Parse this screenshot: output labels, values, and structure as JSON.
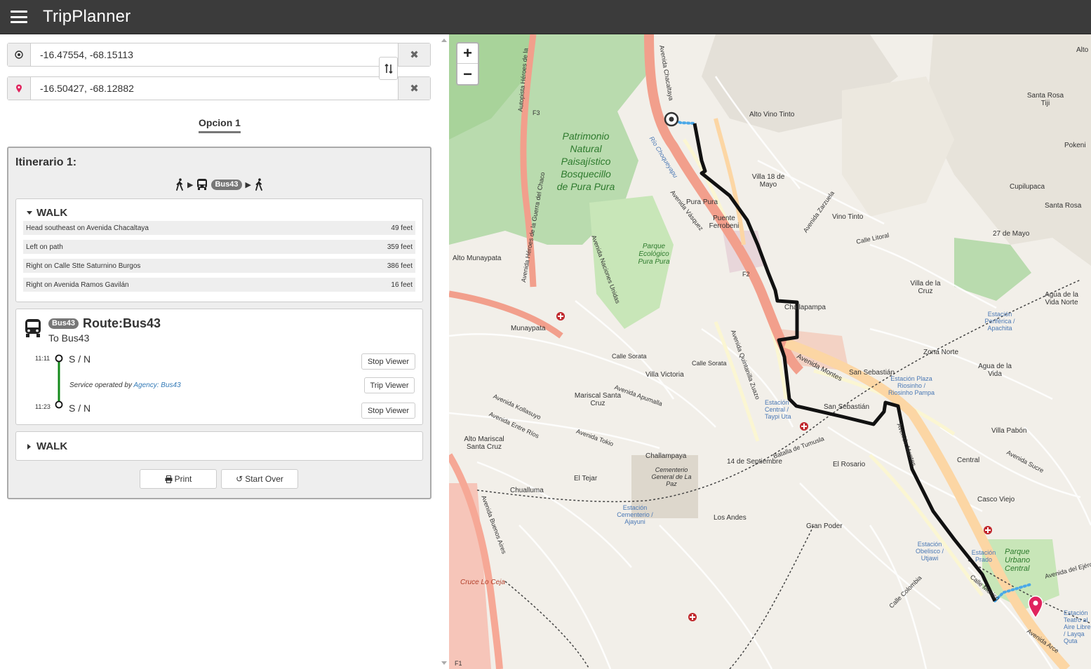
{
  "app": {
    "title": "TripPlanner"
  },
  "origin": {
    "value": "-16.47554, -68.15113"
  },
  "destination": {
    "value": "-16.50427, -68.12882"
  },
  "option_tab": "Opcion 1",
  "itinerary": {
    "title": "Itinerario 1:",
    "route_badge": "Bus43",
    "walk1": {
      "label": "WALK",
      "steps": [
        {
          "text": "Head southeast on Avenida Chacaltaya",
          "dist": "49 feet"
        },
        {
          "text": "Left on path",
          "dist": "359 feet"
        },
        {
          "text": "Right on Calle Stte Saturnino Burgos",
          "dist": "386 feet"
        },
        {
          "text": "Right on Avenida Ramos Gavilán",
          "dist": "16 feet"
        }
      ]
    },
    "transit": {
      "badge": "Bus43",
      "route": "Route:Bus43",
      "to": "To Bus43",
      "start_time": "11:11",
      "start_stop": "S / N",
      "end_time": "11:23",
      "end_stop": "S / N",
      "stop_viewer": "Stop Viewer",
      "trip_viewer": "Trip Viewer",
      "service_prefix": "Service operated by",
      "agency": "Agency: Bus43"
    },
    "walk2": {
      "label": "WALK"
    },
    "print_label": "Print",
    "start_over_label": "Start Over"
  },
  "map": {
    "zoom_in": "+",
    "zoom_out": "−",
    "labels": {
      "patrimonio": "Patrimonio Natural Paisajístico Bosquecillo de Pura Pura",
      "parque_ecologico": "Parque Ecológico Pura Pura",
      "alto_vino_tinto": "Alto Vino Tinto",
      "villa_18": "Villa 18 de Mayo",
      "vino_tinto": "Vino Tinto",
      "pura_pura": "Pura Pura",
      "puente": "Puente Ferrobeni",
      "alto_munaypata": "Alto Munaypata",
      "munaypata": "Munaypata",
      "chijini": "Challapampa",
      "villa_victoria": "Villa Victoria",
      "mariscal": "Mariscal Santa Cruz",
      "alto_mariscal": "Alto Mariscal Santa Cruz",
      "challampaya": "Challampaya",
      "el_tejar": "El Tejar",
      "chualluma": "Chualluma",
      "cementerio": "Cementerio General de La Paz",
      "est_cementerio": "Estación Cementerio / Ajayuni",
      "los_andes": "Los Andes",
      "gran_poder": "Gran Poder",
      "el_rosario": "El Rosario",
      "san_sebastian": "San Sebastián",
      "san_sebastian2": "San Sebastián",
      "zona_norte": "Zona Norte",
      "agua_vida": "Agua de la Vida",
      "agua_vida_norte": "Agua de la Vida Norte",
      "villa_cruz": "Villa de la Cruz",
      "villa_pabon": "Villa Pabón",
      "central": "Central",
      "casco_viejo": "Casco Viejo",
      "parque_urbano": "Parque Urbano Central",
      "santa_rosa": "Santa Rosa",
      "santa_rosa_tiji": "Santa Rosa Tiji",
      "cupilupaca": "Cupilupaca",
      "27_mayo": "27 de Mayo",
      "pokeni": "Pokeni",
      "alto": "Alto",
      "est_central": "Estación Central / Taypi Uta",
      "est_riosinho": "Estación Plaza Riosinho / Riosinho Pampa",
      "est_periferica": "Estación Periférica / Apachita",
      "est_obelisco": "Estación Obelisco / Utjawi",
      "est_prado": "Estación Prado",
      "est_teatro": "Estación Teatro al Aire Libre / Layqa Quta",
      "14_sept": "14 de Septiembre",
      "cruce": "Cruce Lo Ceja",
      "f1": "F1",
      "f2": "F2",
      "f3": "F3",
      "av_montes": "Avenida Montes",
      "av_chacaltaya": "Avenida Chacaltaya",
      "rio_choqueyapu": "Río Choqueyapu",
      "av_vasquez": "Avenida Vásquez",
      "av_quintanilla": "Avenida Quintanilla Zuazo",
      "av_arce": "Avenida Arce",
      "av_sucre": "Avenida Sucre",
      "av_ejercito": "Avenida del Ejército",
      "autopista_heroes": "Autopista Héroes de la",
      "av_heroes_chaco": "Avenida Héroes de la Guerra del Chaco",
      "av_naciones": "Avenida Naciones Unidas",
      "av_apumalla": "Avenida Apumalla",
      "av_kollasuyo": "Avenida Kollasuyo",
      "av_entre_rios": "Avenida Entre Ríos",
      "av_zarzuela": "Avenida Zarzuela",
      "calle_sorata": "Calle Sorata",
      "calle_sorata2": "Calle Sorata",
      "batalla": "Batalla de Tumusla",
      "av_tokio": "Avenida Tokio",
      "calle_litoral": "Calle Litoral",
      "calle_colombia": "Calle Colombia",
      "calle_mexico": "Calle México",
      "montes2": "Avenida Montes",
      "av_buenos_aires": "Avenida Buenos Aires"
    }
  }
}
